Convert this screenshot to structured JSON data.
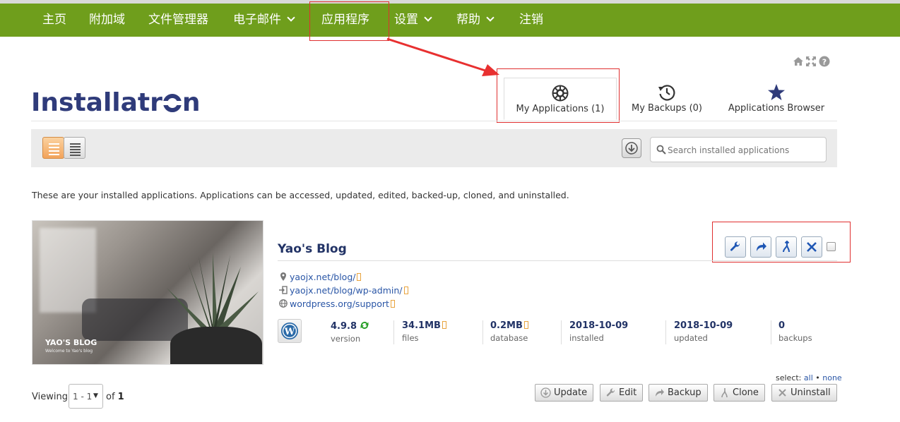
{
  "nav": {
    "items": [
      {
        "label": "主页"
      },
      {
        "label": "附加域"
      },
      {
        "label": "文件管理器"
      },
      {
        "label": "电子邮件"
      },
      {
        "label": "应用程序"
      },
      {
        "label": "设置"
      },
      {
        "label": "帮助"
      },
      {
        "label": "注销"
      }
    ]
  },
  "logo": {
    "text_a": "Installatr",
    "text_b": "n"
  },
  "tabs": [
    {
      "label": "My Applications (1)",
      "icon": "my-applications-icon"
    },
    {
      "label": "My Backups (0)",
      "icon": "backups-clock-icon"
    },
    {
      "label": "Applications Browser",
      "icon": "star-icon"
    }
  ],
  "search": {
    "placeholder": "Search installed applications"
  },
  "intro": "These are your installed applications. Applications can be accessed, updated, edited, backed-up, cloned, and uninstalled.",
  "app": {
    "title": "Yao's Blog",
    "thumb_title": "YAO'S BLOG",
    "thumb_sub": "Welcome to Yao's blog",
    "links": [
      {
        "text": "yaojx.net/blog/",
        "icon": "location-pin-icon"
      },
      {
        "text": "yaojx.net/blog/wp-admin/",
        "icon": "login-icon"
      },
      {
        "text": "wordpress.org/support",
        "icon": "globe-icon"
      }
    ],
    "stats": [
      {
        "value": "4.9.8",
        "label": "version"
      },
      {
        "value": "34.1MB",
        "label": "files"
      },
      {
        "value": "0.2MB",
        "label": "database"
      },
      {
        "value": "2018-10-09",
        "label": "installed"
      },
      {
        "value": "2018-10-09",
        "label": "updated"
      },
      {
        "value": "0",
        "label": "backups"
      }
    ]
  },
  "select": {
    "prefix": "select:",
    "all": "all",
    "bullet": "•",
    "none": "none"
  },
  "pager": {
    "viewing": "Viewing",
    "range": "1 - 1",
    "of": "of",
    "total": "1"
  },
  "buttons": {
    "update": "Update",
    "edit": "Edit",
    "backup": "Backup",
    "clone": "Clone",
    "uninstall": "Uninstall"
  },
  "colors": {
    "nav": "#6f9e1c",
    "accent": "#2a56a6",
    "highlight": "#e03030"
  }
}
